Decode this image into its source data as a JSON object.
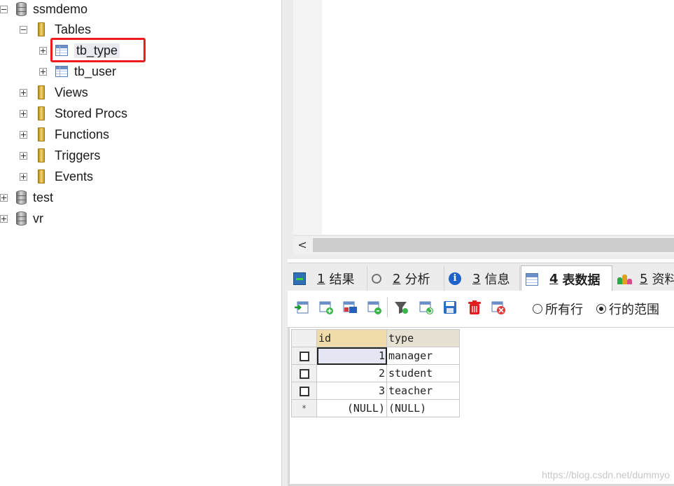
{
  "tree": {
    "root": {
      "label": "ssmdemo"
    },
    "tables_folder": "Tables",
    "tables": [
      {
        "label": "tb_type",
        "selected": true
      },
      {
        "label": "tb_user"
      }
    ],
    "folders": [
      "Views",
      "Stored Procs",
      "Functions",
      "Triggers",
      "Events"
    ],
    "other_databases": [
      "test",
      "vr"
    ]
  },
  "tabs": [
    {
      "num": "1",
      "label": "结果",
      "icon": "result-icon"
    },
    {
      "num": "2",
      "label": "分析",
      "icon": "analyze-icon"
    },
    {
      "num": "3",
      "label": "信息",
      "icon": "info-icon"
    },
    {
      "num": "4",
      "label": "表数据",
      "icon": "table-data-icon",
      "active": true
    },
    {
      "num": "5",
      "label": "资料",
      "icon": "profile-icon"
    }
  ],
  "toolbar": {
    "buttons": [
      "insert-row-icon",
      "duplicate-row-icon",
      "export-icon",
      "import-icon",
      "filter-icon",
      "refresh-icon",
      "save-icon",
      "delete-icon",
      "cancel-icon"
    ],
    "radio_all_rows": "所有行",
    "radio_row_range": "行的范围",
    "selected_radio": "row_range"
  },
  "grid": {
    "columns": [
      "id",
      "type"
    ],
    "rows": [
      {
        "id": "1",
        "type": "manager"
      },
      {
        "id": "2",
        "type": "student"
      },
      {
        "id": "3",
        "type": "teacher"
      }
    ],
    "new_row": {
      "marker": "*",
      "id": "(NULL)",
      "type": "(NULL)"
    }
  },
  "scroll": {
    "left_arrow": "<"
  },
  "watermark": "https://blog.csdn.net/dummyo",
  "colors": {
    "highlight": "#ee1c1c",
    "tab_active_bg": "#ffffff"
  }
}
